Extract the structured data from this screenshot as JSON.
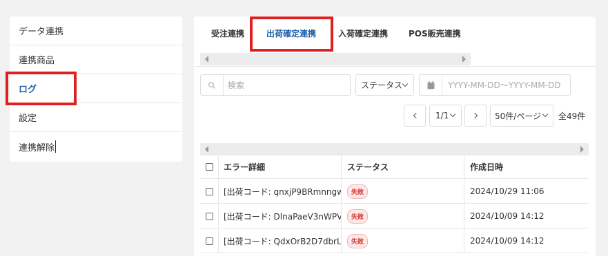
{
  "sidebar": {
    "items": [
      {
        "label": "データ連携"
      },
      {
        "label": "連携商品"
      },
      {
        "label": "ログ"
      },
      {
        "label": "設定"
      },
      {
        "label": "連携解除"
      }
    ]
  },
  "tabs": [
    {
      "label": "受注連携"
    },
    {
      "label": "出荷確定連携"
    },
    {
      "label": "入荷確定連携"
    },
    {
      "label": "POS販売連携"
    }
  ],
  "filters": {
    "search_placeholder": "検索",
    "status_label": "ステータス",
    "date_placeholder": "YYYY-MM-DD〜YYYY-MM-DD"
  },
  "pagination": {
    "page": "1/1",
    "per_page": "50件/ページ",
    "total": "全49件"
  },
  "table": {
    "headers": [
      "エラー詳細",
      "ステータス",
      "作成日時"
    ],
    "rows": [
      {
        "detail": "[出荷コード: qnxjP9BRmnngw",
        "status": "失敗",
        "created": "2024/10/29 11:06"
      },
      {
        "detail": "[出荷コード: DlnaPaeV3nWPV",
        "status": "失敗",
        "created": "2024/10/09 14:12"
      },
      {
        "detail": "[出荷コード: QdxOrB2D7dbrL",
        "status": "失敗",
        "created": "2024/10/09 14:12"
      }
    ]
  },
  "colors": {
    "accent": "#1e5fa8",
    "highlight": "#e02020",
    "fail_badge": "#d33a3a"
  }
}
